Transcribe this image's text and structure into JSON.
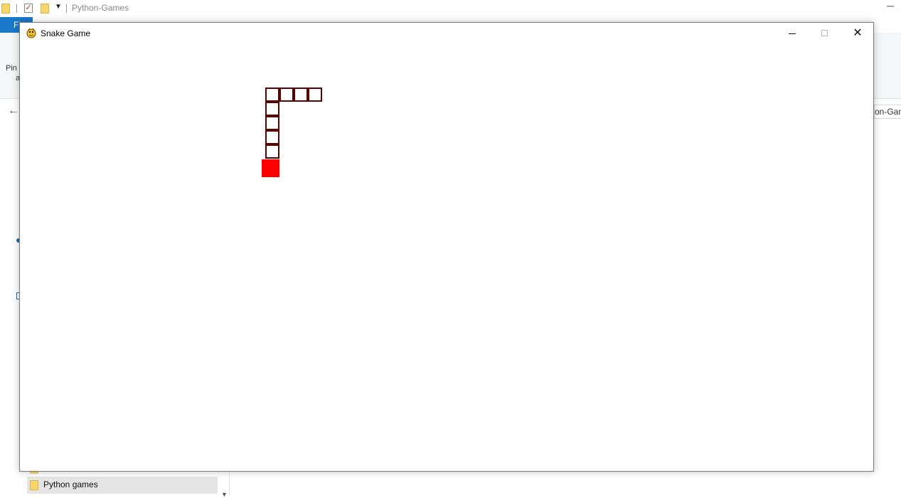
{
  "explorer": {
    "title": "Python-Games",
    "file_tab": "Fi",
    "ribbon_pin": "Pin",
    "ribbon_pin2": "a",
    "address_fragment": "on-Gam",
    "nav_selected": "Python games",
    "minimize_glyph": "─",
    "back_glyph": "←"
  },
  "game_window": {
    "title": "Snake Game",
    "controls": {
      "minimize_icon": "minimize-icon",
      "maximize_icon": "maximize-icon",
      "close_icon": "close-icon",
      "close_glyph": "✕"
    }
  },
  "game": {
    "cell_size": 20,
    "snake": [
      {
        "col": 0,
        "row": 0
      },
      {
        "col": 1,
        "row": 0
      },
      {
        "col": 2,
        "row": 0
      },
      {
        "col": 3,
        "row": 0
      },
      {
        "col": 0,
        "row": 1
      },
      {
        "col": 0,
        "row": 2
      },
      {
        "col": 0,
        "row": 3
      },
      {
        "col": 0,
        "row": 4
      }
    ],
    "food": {
      "col": 0,
      "row": 5
    },
    "colors": {
      "snake_border": "#5c0000",
      "snake_fill": "#ffffff",
      "food": "#ff0000",
      "background": "#ffffff"
    }
  }
}
